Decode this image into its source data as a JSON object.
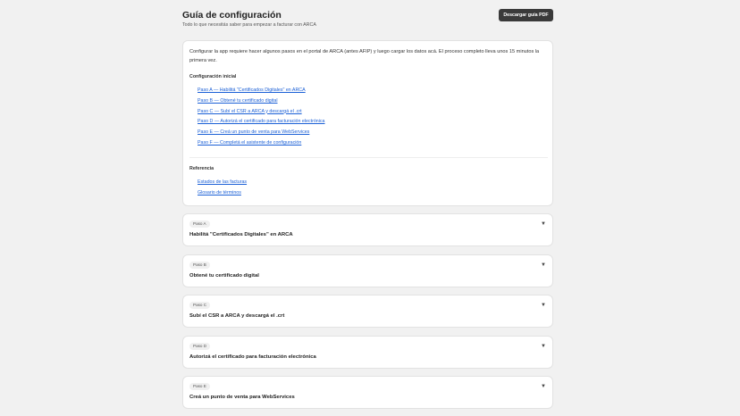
{
  "header": {
    "title": "Guía de configuración",
    "subtitle": "Todo lo que necesitás saber para empezar a facturar con ARCA",
    "pdf_button": "Descargar guía PDF"
  },
  "intro": {
    "text": "Configurar la app requiere hacer algunos pasos en el portal de ARCA (antes AFIP) y luego cargar los datos acá. El proceso completo lleva unos 15 minutos la primera vez.",
    "setup_heading": "Configuración inicial",
    "setup_links": [
      "Paso A — Habilitá \"Certificados Digitales\" en ARCA",
      "Paso B — Obtené tu certificado digital",
      "Paso C — Subí el CSR a ARCA y descargá el .crt",
      "Paso D — Autorizá el certificado para facturación electrónica",
      "Paso E — Creá un punto de venta para WebServices",
      "Paso F — Completá el asistente de configuración"
    ],
    "reference_heading": "Referencia",
    "reference_links": [
      "Estados de las facturas",
      "Glosario de términos"
    ]
  },
  "steps": [
    {
      "badge": "Paso A",
      "title": "Habilitá \"Certificados Digitales\" en ARCA"
    },
    {
      "badge": "Paso B",
      "title": "Obtené tu certificado digital"
    },
    {
      "badge": "Paso C",
      "title": "Subí el CSR a ARCA y descargá el .crt"
    },
    {
      "badge": "Paso D",
      "title": "Autorizá el certificado para facturación electrónica"
    },
    {
      "badge": "Paso E",
      "title": "Creá un punto de venta para WebServices"
    }
  ],
  "icons": {
    "expand": "chevron-down-icon"
  }
}
